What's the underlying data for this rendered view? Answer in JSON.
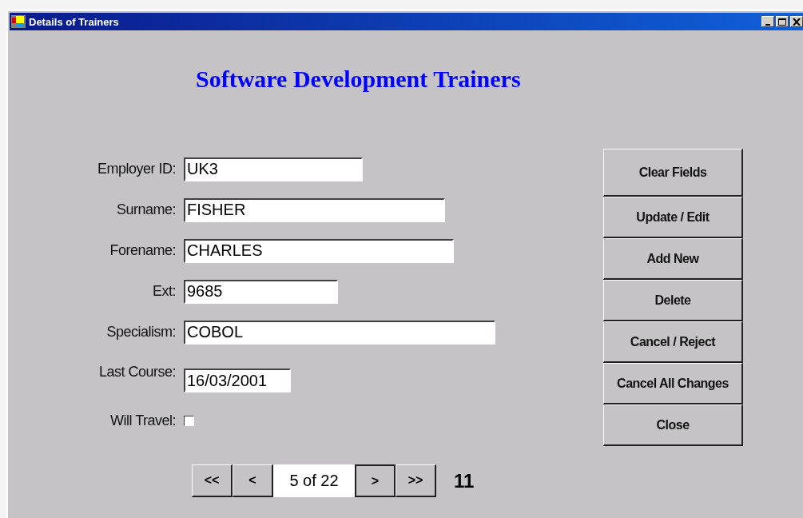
{
  "window": {
    "title": "Details of Trainers"
  },
  "heading": "Software Development Trainers",
  "fields": [
    {
      "kind": "text",
      "label": "Employer ID:",
      "value": "UK3"
    },
    {
      "kind": "text",
      "label": "Surname:",
      "value": "FISHER"
    },
    {
      "kind": "text",
      "label": "Forename:",
      "value": "CHARLES"
    },
    {
      "kind": "text",
      "label": "Ext:",
      "value": "9685"
    },
    {
      "kind": "text",
      "label": "Specialism:",
      "value": "COBOL"
    },
    {
      "kind": "text",
      "label": "Last Course:",
      "value": "16/03/2001"
    },
    {
      "kind": "checkbox",
      "label": "Will Travel:",
      "checked": false
    }
  ],
  "buttons": [
    "Clear Fields",
    "Update / Edit",
    "Add New",
    "Delete",
    "Cancel / Reject",
    "Cancel All Changes",
    "Close"
  ],
  "navigator": {
    "first": "<<",
    "previous": "<",
    "position": "5 of 22",
    "next": ">",
    "last": ">>"
  },
  "record_number": "11"
}
